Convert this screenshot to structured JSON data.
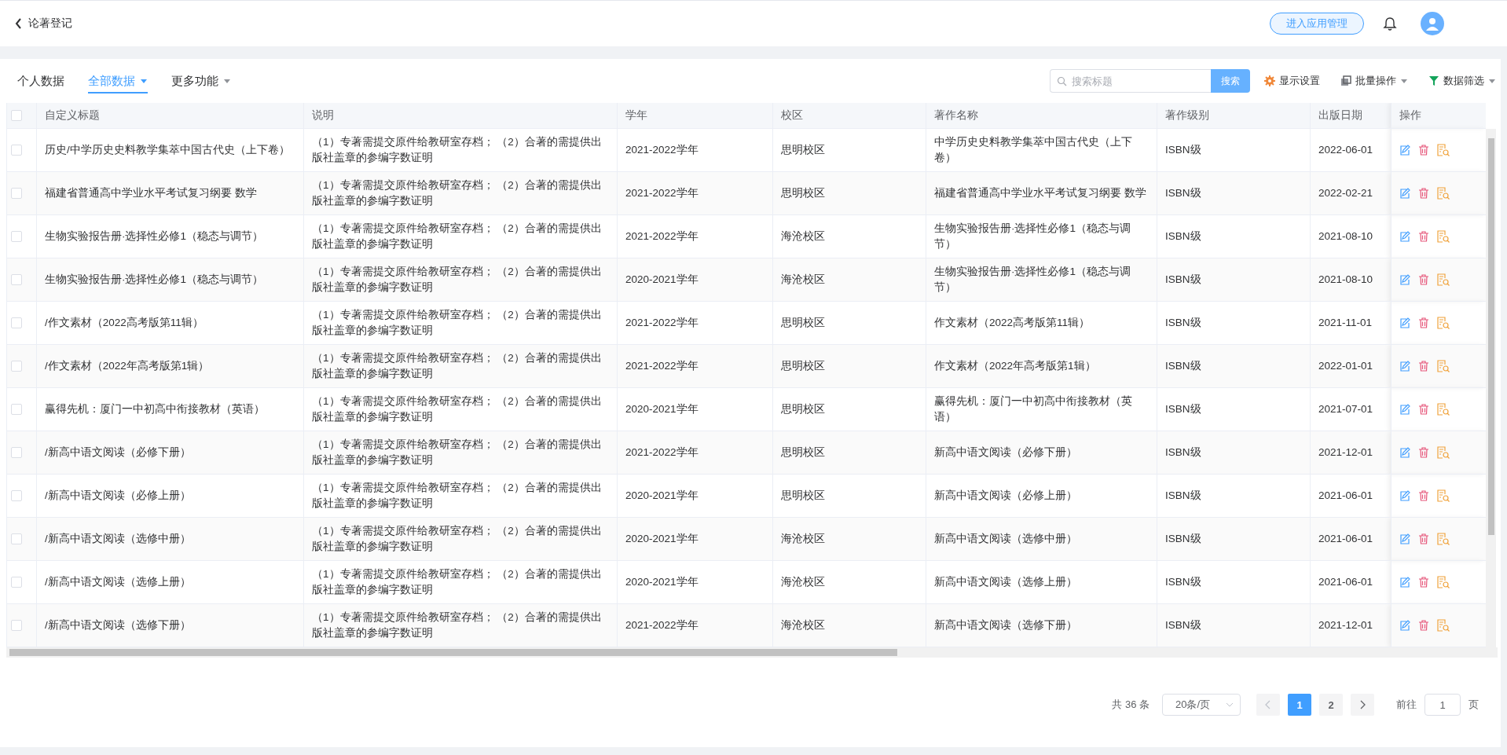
{
  "header": {
    "title": "论著登记",
    "admin_button": "进入应用管理"
  },
  "tabs": [
    {
      "label": "个人数据",
      "selected": false,
      "dropdown": false
    },
    {
      "label": "全部数据",
      "selected": true,
      "dropdown": true
    },
    {
      "label": "更多功能",
      "selected": false,
      "dropdown": true
    }
  ],
  "search": {
    "placeholder": "搜索标题",
    "button": "搜索"
  },
  "actions": [
    {
      "kind": "settings",
      "label": "显示设置",
      "dropdown": false
    },
    {
      "kind": "batch",
      "label": "批量操作",
      "dropdown": true
    },
    {
      "kind": "filter",
      "label": "数据筛选",
      "dropdown": true
    }
  ],
  "table": {
    "select_all": {
      "checked": false
    },
    "columns": [
      "自定义标题",
      "说明",
      "学年",
      "校区",
      "著作名称",
      "著作级别",
      "出版日期",
      "操作"
    ],
    "rows": [
      {
        "checked": false,
        "cells": [
          "历史/中学历史史料教学集萃中国古代史（上下卷）",
          "（1）专著需提交原件给教研室存档；  （2）合著的需提供出版社盖章的参编字数证明",
          "2021-2022学年",
          "思明校区",
          "中学历史史料教学集萃中国古代史（上下卷）",
          "ISBN级",
          "2022-06-01"
        ]
      },
      {
        "checked": false,
        "cells": [
          "福建省普通高中学业水平考试复习纲要 数学",
          "（1）专著需提交原件给教研室存档；  （2）合著的需提供出版社盖章的参编字数证明",
          "2021-2022学年",
          "思明校区",
          "福建省普通高中学业水平考试复习纲要 数学",
          "ISBN级",
          "2022-02-21"
        ]
      },
      {
        "checked": false,
        "cells": [
          "生物实验报告册·选择性必修1（稳态与调节）",
          "（1）专著需提交原件给教研室存档；  （2）合著的需提供出版社盖章的参编字数证明",
          "2021-2022学年",
          "海沧校区",
          "生物实验报告册·选择性必修1（稳态与调节）",
          "ISBN级",
          "2021-08-10"
        ]
      },
      {
        "checked": false,
        "cells": [
          "生物实验报告册·选择性必修1（稳态与调节）",
          "（1）专著需提交原件给教研室存档；  （2）合著的需提供出版社盖章的参编字数证明",
          "2020-2021学年",
          "海沧校区",
          "生物实验报告册·选择性必修1（稳态与调节）",
          "ISBN级",
          "2021-08-10"
        ]
      },
      {
        "checked": false,
        "cells": [
          "/作文素材（2022高考版第11辑）",
          "（1）专著需提交原件给教研室存档；  （2）合著的需提供出版社盖章的参编字数证明",
          "2021-2022学年",
          "思明校区",
          "作文素材（2022高考版第11辑）",
          "ISBN级",
          "2021-11-01"
        ]
      },
      {
        "checked": false,
        "cells": [
          "/作文素材（2022年高考版第1辑）",
          "（1）专著需提交原件给教研室存档；  （2）合著的需提供出版社盖章的参编字数证明",
          "2021-2022学年",
          "思明校区",
          "作文素材（2022年高考版第1辑）",
          "ISBN级",
          "2022-01-01"
        ]
      },
      {
        "checked": false,
        "cells": [
          "赢得先机：厦门一中初高中衔接教材（英语）",
          "（1）专著需提交原件给教研室存档；  （2）合著的需提供出版社盖章的参编字数证明",
          "2020-2021学年",
          "思明校区",
          "赢得先机：厦门一中初高中衔接教材（英语）",
          "ISBN级",
          "2021-07-01"
        ]
      },
      {
        "checked": false,
        "cells": [
          "/新高中语文阅读（必修下册）",
          "（1）专著需提交原件给教研室存档；  （2）合著的需提供出版社盖章的参编字数证明",
          "2021-2022学年",
          "思明校区",
          "新高中语文阅读（必修下册）",
          "ISBN级",
          "2021-12-01"
        ]
      },
      {
        "checked": false,
        "cells": [
          "/新高中语文阅读（必修上册）",
          "（1）专著需提交原件给教研室存档；  （2）合著的需提供出版社盖章的参编字数证明",
          "2020-2021学年",
          "思明校区",
          "新高中语文阅读（必修上册）",
          "ISBN级",
          "2021-06-01"
        ]
      },
      {
        "checked": false,
        "cells": [
          "/新高中语文阅读（选修中册）",
          "（1）专著需提交原件给教研室存档；  （2）合著的需提供出版社盖章的参编字数证明",
          "2020-2021学年",
          "海沧校区",
          "新高中语文阅读（选修中册）",
          "ISBN级",
          "2021-06-01"
        ]
      },
      {
        "checked": false,
        "cells": [
          "/新高中语文阅读（选修上册）",
          "（1）专著需提交原件给教研室存档；  （2）合著的需提供出版社盖章的参编字数证明",
          "2020-2021学年",
          "海沧校区",
          "新高中语文阅读（选修上册）",
          "ISBN级",
          "2021-06-01"
        ]
      },
      {
        "checked": false,
        "cells": [
          "/新高中语文阅读（选修下册）",
          "（1）专著需提交原件给教研室存档；  （2）合著的需提供出版社盖章的参编字数证明",
          "2021-2022学年",
          "海沧校区",
          "新高中语文阅读（选修下册）",
          "ISBN级",
          "2021-12-01"
        ]
      }
    ]
  },
  "pagination": {
    "total": "共 36 条",
    "page_size": "20条/页",
    "prev": {
      "disabled": true
    },
    "next": {
      "disabled": false
    },
    "pages": [
      {
        "label": "1",
        "selected": true
      },
      {
        "label": "2",
        "selected": false
      }
    ],
    "goto_label": "前往",
    "goto_value": "1",
    "page_suffix": "页"
  }
}
